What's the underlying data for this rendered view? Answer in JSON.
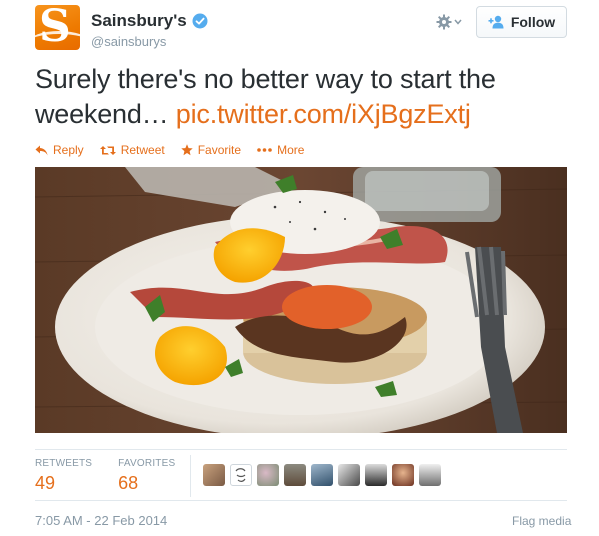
{
  "header": {
    "display_name": "Sainsbury's",
    "handle": "@sainsburys",
    "verified_icon": "verified-badge-icon",
    "follow_label": "Follow",
    "follow_icon": "add-person-icon",
    "menu_icon": "gear-icon"
  },
  "tweet": {
    "text": "Surely there's no better way to start the weekend… ",
    "link": "pic.twitter.com/iXjBgzExtj"
  },
  "actions": [
    {
      "label": "Reply",
      "icon": "reply-icon"
    },
    {
      "label": "Retweet",
      "icon": "retweet-icon"
    },
    {
      "label": "Favorite",
      "icon": "star-icon"
    },
    {
      "label": "More",
      "icon": "more-dots-icon"
    }
  ],
  "media": {
    "description_icon": "photo"
  },
  "stats": {
    "retweets_label": "RETWEETS",
    "retweets_value": "49",
    "favorites_label": "FAVORITES",
    "favorites_value": "68"
  },
  "footer": {
    "timestamp": "7:05 AM - 22 Feb 2014",
    "flag_label": "Flag media"
  },
  "colors": {
    "accent": "#e56f1c",
    "text": "#292f33",
    "muted": "#8899a6",
    "verified": "#55acee",
    "brand": "#f7941d"
  }
}
